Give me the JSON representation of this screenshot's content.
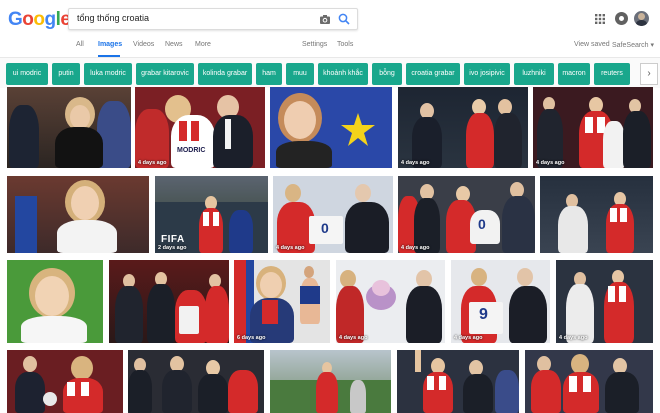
{
  "logo": {
    "letters": [
      "G",
      "o",
      "o",
      "g",
      "l",
      "e"
    ],
    "colors": [
      "#4285f4",
      "#ea4335",
      "#fbbc05",
      "#4285f4",
      "#34a853",
      "#ea4335"
    ]
  },
  "search": {
    "query": "tổng thống croatia"
  },
  "tabs": [
    {
      "label": "All"
    },
    {
      "label": "Images",
      "active": true
    },
    {
      "label": "Videos"
    },
    {
      "label": "News"
    },
    {
      "label": "More"
    },
    {
      "label": "Settings"
    },
    {
      "label": "Tools"
    },
    {
      "label": "View saved"
    },
    {
      "label": "SafeSearch ▾"
    }
  ],
  "chips": [
    "ui modric",
    "putin",
    "luka modric",
    "grabar kitarovic",
    "kolinda grabar",
    "ham",
    "muu",
    "khoảnh khắc",
    "bỗng",
    "croatia grabar",
    "ivo josipivic",
    "luzhniki",
    "macron",
    "reuters"
  ],
  "chip_next": "›",
  "ages": [
    "",
    "4 days ago",
    "",
    "4 days ago",
    "4 days ago",
    "",
    "2 days ago",
    "4 days ago",
    "4 days ago",
    "",
    "",
    "",
    "6 days ago",
    "4 days ago",
    "4 days ago",
    "4 days ago",
    "4 days ago"
  ],
  "fifa_text": "FIFA",
  "jersey_text": {
    "modric": "MODRIC",
    "num": "0",
    "num9": "9"
  },
  "colors": {
    "chip": "#19a78c",
    "accent": "#1a73e8",
    "croatia_red": "#d42a2a"
  }
}
